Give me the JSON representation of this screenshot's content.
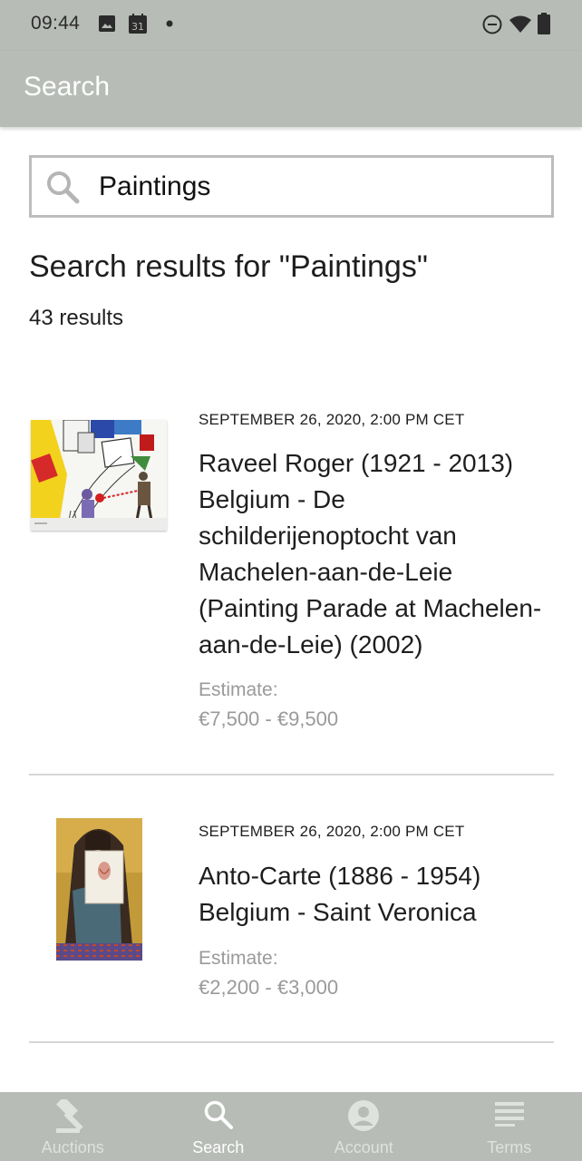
{
  "status_bar": {
    "time": "09:44",
    "calendar_day": "31"
  },
  "app_bar": {
    "title": "Search"
  },
  "search": {
    "value": "Paintings"
  },
  "results": {
    "heading": "Search results for \"Paintings\"",
    "count": "43 results",
    "items": [
      {
        "date": "SEPTEMBER 26, 2020, 2:00 PM CET",
        "title": "Raveel Roger (1921 - 2013)  Belgium - De schilderijenoptocht van Machelen-aan-de-Leie (Painting Parade at Machelen-aan-de-Leie)  (2002)",
        "estimate_label": "Estimate:",
        "estimate_value": "€7,500 - €9,500"
      },
      {
        "date": "SEPTEMBER 26, 2020, 2:00 PM CET",
        "title": "Anto-Carte  (1886 - 1954) Belgium - Saint Veronica",
        "estimate_label": "Estimate:",
        "estimate_value": "€2,200 - €3,000"
      }
    ]
  },
  "bottom_nav": [
    {
      "label": "Auctions",
      "icon": "gavel-icon",
      "active": false
    },
    {
      "label": "Search",
      "icon": "search-icon",
      "active": true
    },
    {
      "label": "Account",
      "icon": "account-icon",
      "active": false
    },
    {
      "label": "Terms",
      "icon": "terms-icon",
      "active": false
    }
  ],
  "colors": {
    "bar": "#b7bcb6",
    "text": "#1e1e1e",
    "muted": "#9a9a9a",
    "divider": "#d6d6d6"
  }
}
